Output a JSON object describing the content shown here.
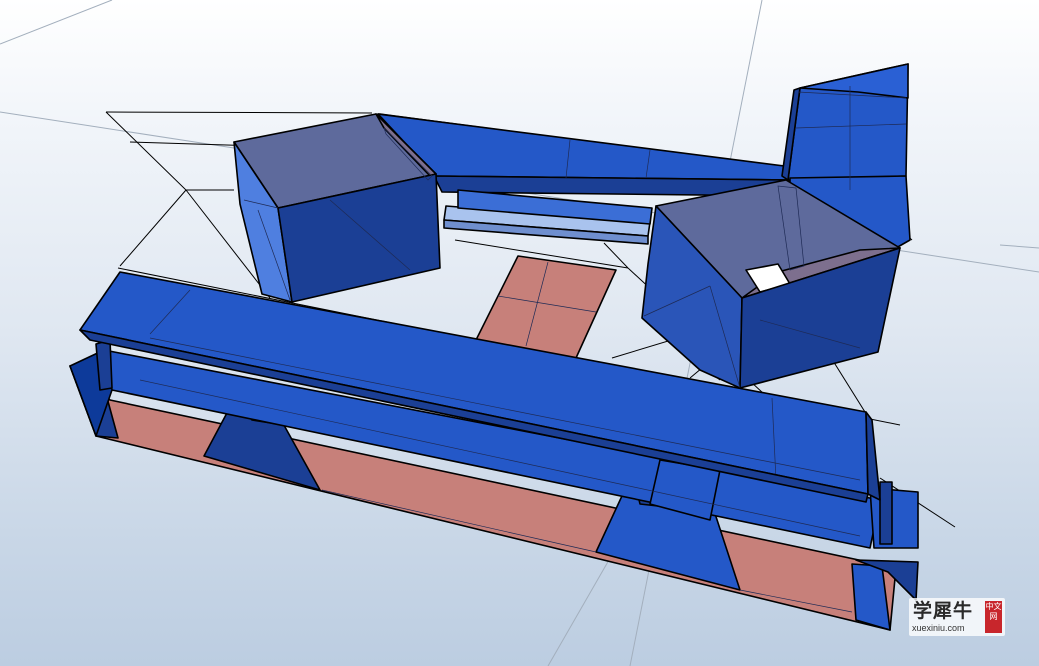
{
  "watermark": {
    "brand": "学犀牛",
    "url": "xuexiniu.com",
    "badge": "中文网"
  },
  "colors": {
    "structure_blue": "#2458c8",
    "structure_blue_dark": "#1b3f95",
    "structure_blue_deep": "#162f7a",
    "structure_blue_light": "#4f7fe0",
    "slab_pink": "#c7807a",
    "glass_mauve": "#5e6a9c",
    "background_top": "#ffffff",
    "background_bottom": "#bccde1",
    "grid_line": "#a3afbd",
    "edge_line": "#000000"
  },
  "view": {
    "type": "3d-perspective-viewport",
    "content": "blue building mass model with pink floor slabs on a ground grid"
  }
}
